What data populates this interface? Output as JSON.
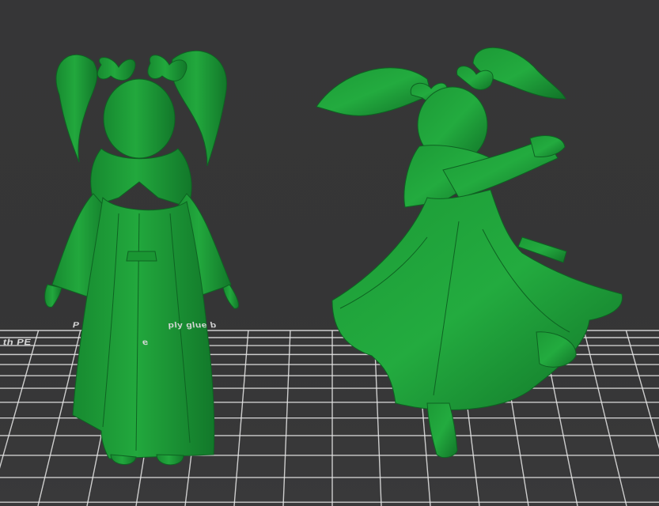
{
  "viewport": {
    "background_color": "#363637",
    "grid_color": "#e8e8e8",
    "model_color": "#1fa13a",
    "model_shadow_color": "#0f6b22",
    "model_highlight_color": "#3ccc57"
  },
  "build_plate": {
    "notice_line_1": "P",
    "notice_line_1b": "ply glue b",
    "notice_line_2": "th PE",
    "notice_line_2b": "e"
  },
  "models": [
    {
      "name": "figure-standing",
      "pose": "standing"
    },
    {
      "name": "figure-action",
      "pose": "action"
    }
  ]
}
